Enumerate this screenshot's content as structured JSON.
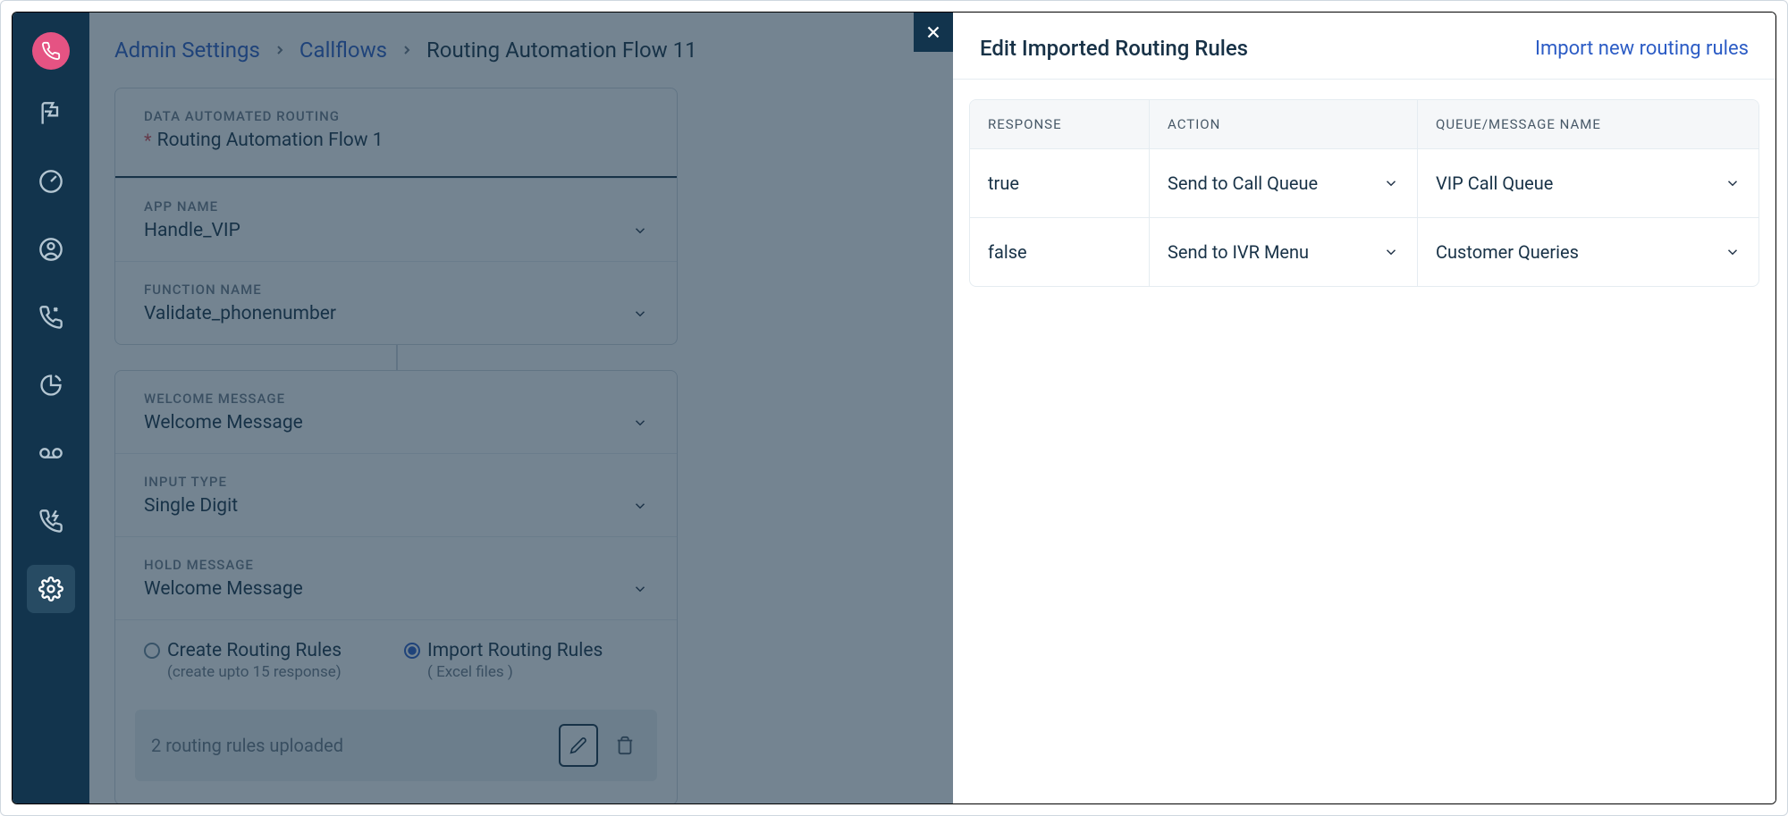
{
  "breadcrumb": {
    "admin": "Admin Settings",
    "callflows": "Callflows",
    "current": "Routing Automation Flow 11"
  },
  "card": {
    "section_label": "DATA AUTOMATED ROUTING",
    "section_value": "Routing Automation Flow 1",
    "app_label": "APP NAME",
    "app_value": "Handle_VIP",
    "fn_label": "FUNCTION NAME",
    "fn_value": "Validate_phonenumber",
    "welcome_label": "WELCOME MESSAGE",
    "welcome_value": "Welcome Message",
    "input_label": "INPUT TYPE",
    "input_value": "Single Digit",
    "hold_label": "HOLD MESSAGE",
    "hold_value": "Welcome Message"
  },
  "radios": {
    "create_label": "Create Routing Rules",
    "create_sub": "(create upto 15 response)",
    "import_label": "Import Routing Rules",
    "import_sub": "( Excel files )"
  },
  "upload": {
    "status": "2 routing rules uploaded"
  },
  "panel": {
    "title": "Edit Imported Routing Rules",
    "link": "Import new routing rules",
    "headers": {
      "response": "RESPONSE",
      "action": "ACTION",
      "queue": "QUEUE/MESSAGE NAME"
    },
    "rows": [
      {
        "response": "true",
        "action": "Send to Call Queue",
        "queue": "VIP Call Queue"
      },
      {
        "response": "false",
        "action": "Send to IVR Menu",
        "queue": "Customer Queries"
      }
    ]
  }
}
